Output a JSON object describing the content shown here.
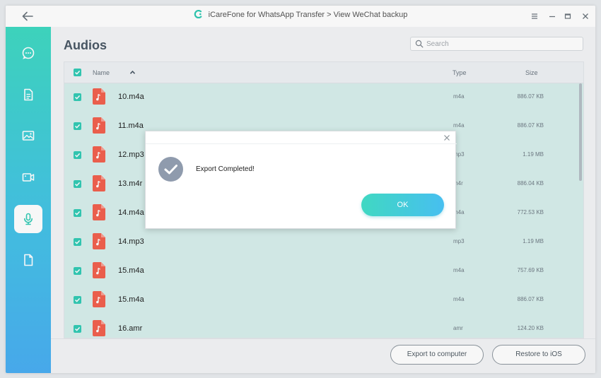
{
  "window": {
    "title": "iCareFone for WhatsApp Transfer > View WeChat backup"
  },
  "sidebar": {
    "items": [
      {
        "icon": "chat-icon",
        "active": false
      },
      {
        "icon": "document-icon",
        "active": false
      },
      {
        "icon": "image-icon",
        "active": false
      },
      {
        "icon": "video-icon",
        "active": false
      },
      {
        "icon": "microphone-icon",
        "active": true
      },
      {
        "icon": "file-icon",
        "active": false
      }
    ]
  },
  "main": {
    "title": "Audios",
    "search": {
      "placeholder": "Search",
      "value": ""
    },
    "columns": {
      "name": "Name",
      "type": "Type",
      "size": "Size"
    },
    "rows": [
      {
        "name": "10.m4a",
        "type": "m4a",
        "size": "886.07 KB",
        "checked": true
      },
      {
        "name": "11.m4a",
        "type": "m4a",
        "size": "886.07 KB",
        "checked": true
      },
      {
        "name": "12.mp3",
        "type": "mp3",
        "size": "1.19 MB",
        "checked": true
      },
      {
        "name": "13.m4r",
        "type": "m4r",
        "size": "886.04 KB",
        "checked": true
      },
      {
        "name": "14.m4a",
        "type": "m4a",
        "size": "772.53 KB",
        "checked": true
      },
      {
        "name": "14.mp3",
        "type": "mp3",
        "size": "1.19 MB",
        "checked": true
      },
      {
        "name": "15.m4a",
        "type": "m4a",
        "size": "757.69 KB",
        "checked": true
      },
      {
        "name": "15.m4a",
        "type": "m4a",
        "size": "886.07 KB",
        "checked": true
      },
      {
        "name": "16.amr",
        "type": "amr",
        "size": "124.20 KB",
        "checked": true
      }
    ]
  },
  "footer": {
    "export_label": "Export to computer",
    "restore_label": "Restore to iOS"
  },
  "modal": {
    "message": "Export Completed!",
    "ok_label": "OK"
  },
  "colors": {
    "accent": "#33cbb5",
    "file_icon": "#f2624f",
    "row_bg": "#d7efec",
    "sidebar_top": "#3fd9c2",
    "sidebar_bottom": "#4aaef2"
  }
}
